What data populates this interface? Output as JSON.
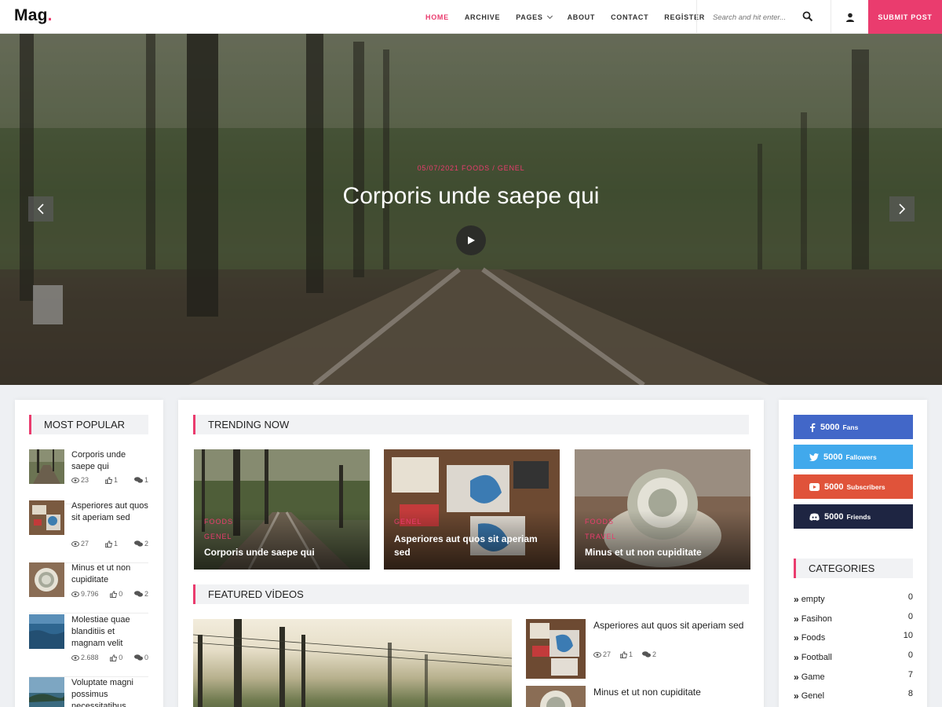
{
  "header": {
    "logo": "Mag",
    "logo_dot": ".",
    "nav": [
      {
        "label": "HOME"
      },
      {
        "label": "ARCHIVE"
      },
      {
        "label": "PAGES"
      },
      {
        "label": "ABOUT"
      },
      {
        "label": "CONTACT"
      },
      {
        "label": "REGİSTER"
      }
    ],
    "search_placeholder": "Search and hit enter...",
    "submit_label": "SUBMIT POST"
  },
  "hero": {
    "date": "05/07/2021",
    "categories": "FOODS  /  GENEL",
    "title": "Corporis unde saepe qui"
  },
  "most_popular": {
    "title": "MOST POPULAR",
    "items": [
      {
        "title": "Corporis unde saepe qui",
        "views": "23",
        "likes": "1",
        "comments": "1"
      },
      {
        "title": "Asperiores aut quos sit aperiam sed",
        "views": "27",
        "likes": "1",
        "comments": "2"
      },
      {
        "title": "Minus et ut non cupiditate",
        "views": "9.796",
        "likes": "0",
        "comments": "2"
      },
      {
        "title": "Molestiae quae blanditiis et magnam velit",
        "views": "2.688",
        "likes": "0",
        "comments": "0"
      },
      {
        "title": "Voluptate magni possimus necessitatibus",
        "views": "",
        "likes": "",
        "comments": ""
      }
    ]
  },
  "trending": {
    "title": "TRENDING NOW",
    "items": [
      {
        "cat1": "FOODS",
        "cat2": "GENEL",
        "title": "Corporis unde saepe qui"
      },
      {
        "cat1": "GENEL",
        "cat2": "",
        "title": "Asperiores aut quos sit aperiam sed"
      },
      {
        "cat1": "FOODS",
        "cat2": "TRAVEL",
        "title": "Minus et ut non cupiditate"
      }
    ]
  },
  "featured": {
    "title": "FEATURED VİDEOS",
    "items": [
      {
        "title": "Asperiores aut quos sit aperiam sed",
        "views": "27",
        "likes": "1",
        "comments": "2"
      },
      {
        "title": "Minus et ut non cupiditate"
      }
    ]
  },
  "social": [
    {
      "network": "facebook",
      "count": "5000",
      "label": "Fans",
      "color": "#4267c8"
    },
    {
      "network": "twitter",
      "count": "5000",
      "label": "Fallowers",
      "color": "#41a9ec"
    },
    {
      "network": "youtube",
      "count": "5000",
      "label": "Subscribers",
      "color": "#e0533a"
    },
    {
      "network": "discord",
      "count": "5000",
      "label": "Friends",
      "color": "#1e2542"
    }
  ],
  "categories": {
    "title": "CATEGORIES",
    "items": [
      {
        "name": "empty",
        "count": "0"
      },
      {
        "name": "Fasihon",
        "count": "0"
      },
      {
        "name": "Foods",
        "count": "10"
      },
      {
        "name": "Football",
        "count": "0"
      },
      {
        "name": "Game",
        "count": "7"
      },
      {
        "name": "Genel",
        "count": "8"
      }
    ]
  },
  "colors": {
    "accent": "#ea3c6e"
  }
}
